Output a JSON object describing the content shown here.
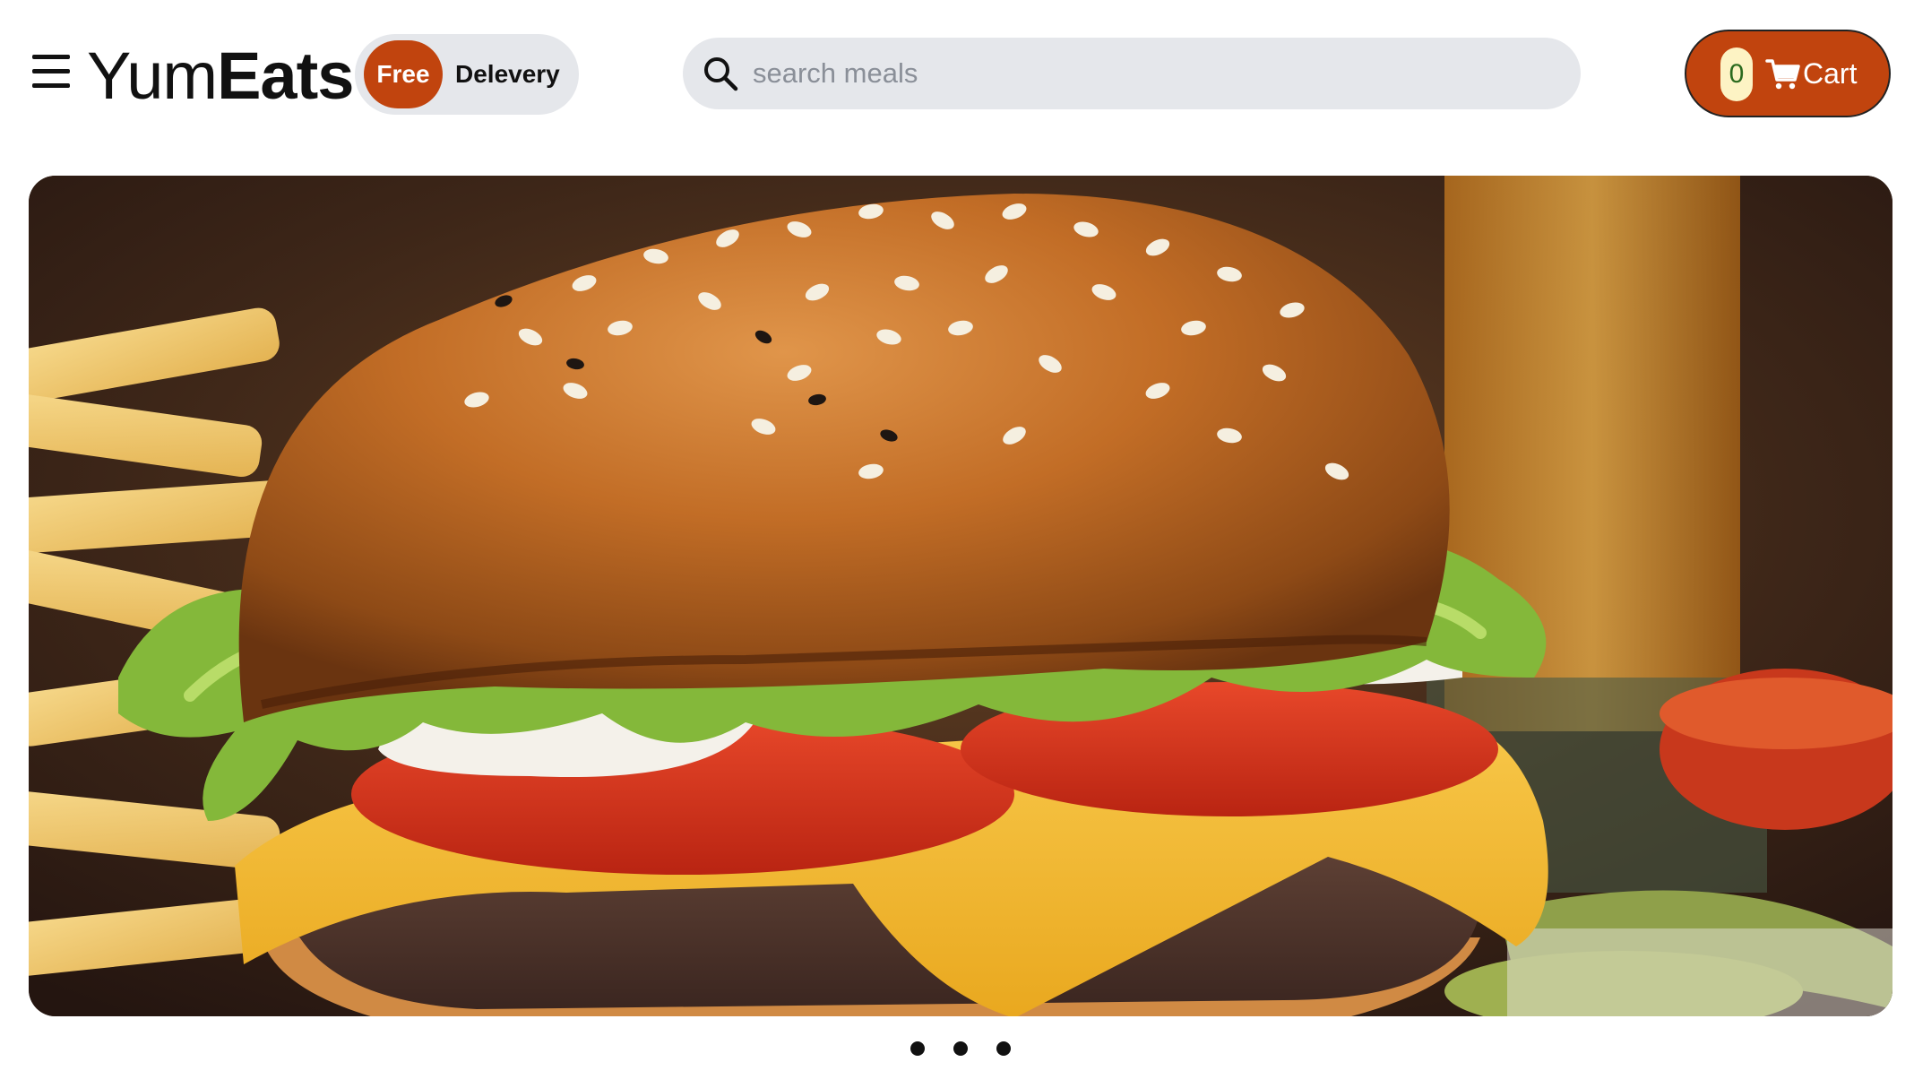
{
  "header": {
    "brand": {
      "part1": "Yum",
      "part2": "Eats"
    },
    "delivery": {
      "badge": "Free",
      "label": "Delevery"
    },
    "search": {
      "placeholder": "search meals",
      "value": "",
      "icon": "search-icon"
    },
    "cart": {
      "count": "0",
      "label": "Cart",
      "icon": "cart-icon"
    },
    "menu_icon": "hamburger-icon"
  },
  "hero": {
    "image": "burger-hero-image",
    "slides_count": 3,
    "active_slide": 1
  },
  "colors": {
    "accent": "#c1440e",
    "pill_bg": "#e5e7eb",
    "cart_count_bg": "#fdf3c4",
    "cart_count_text": "#2b6a1e",
    "dot": "#111111"
  }
}
